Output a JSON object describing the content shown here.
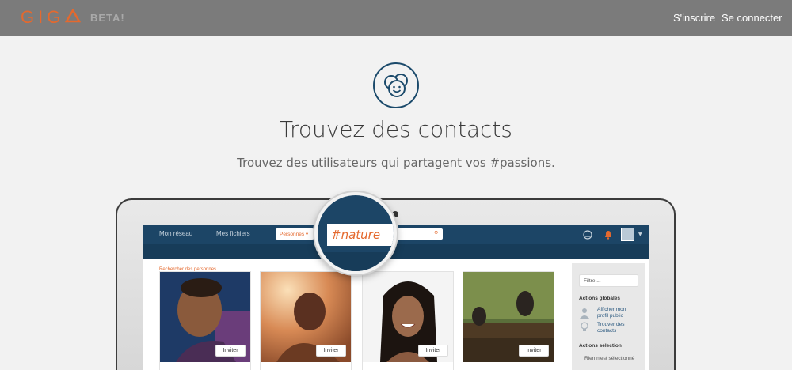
{
  "header": {
    "logo": "GIG",
    "beta": "BETA!",
    "signup": "S'inscrire",
    "login": "Se connecter"
  },
  "hero": {
    "icon": "smiley-group-icon",
    "title": "Trouvez des contacts",
    "subtitle": "Trouvez des utilisateurs qui partagent vos #passions."
  },
  "app": {
    "nav": [
      "Mon réseau",
      "Mes fichiers"
    ],
    "select": "Personnes",
    "search_value": "#nature",
    "sublink": "Rechercher des personnes",
    "cards": [
      {
        "invite": "Inviter"
      },
      {
        "invite": "Inviter"
      },
      {
        "invite": "Inviter"
      },
      {
        "invite": "Inviter"
      }
    ],
    "sidebar": {
      "filter_placeholder": "Filtre ...",
      "global_heading": "Actions globales",
      "links": [
        "Afficher mon profil public",
        "Trouver des contacts"
      ],
      "selection_heading": "Actions sélection",
      "selection_note": "Rien n'est sélectionné"
    }
  },
  "colors": {
    "accent": "#e4692e",
    "navy": "#1c4566",
    "topbar": "#7b7b7b"
  }
}
